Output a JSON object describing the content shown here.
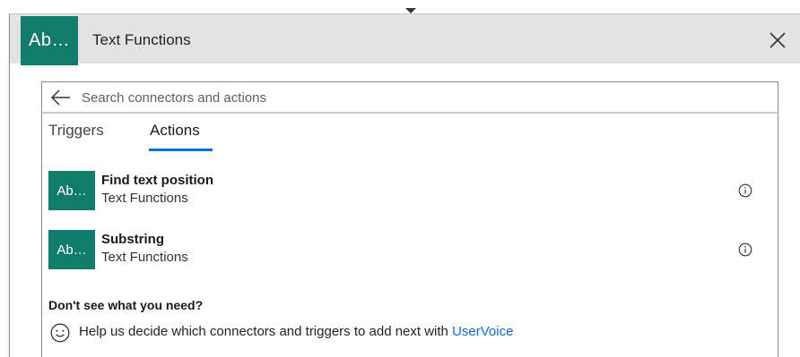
{
  "header": {
    "logo_text": "Ab…",
    "title": "Text Functions",
    "close_icon": "close-icon"
  },
  "search": {
    "back_icon": "back-arrow-icon",
    "placeholder": "Search connectors and actions",
    "value": ""
  },
  "tabs": [
    {
      "label": "Triggers",
      "selected": false
    },
    {
      "label": "Actions",
      "selected": true
    }
  ],
  "actions": [
    {
      "icon_text": "Ab…",
      "name": "Find text position",
      "connector": "Text Functions",
      "info_icon": "info-icon"
    },
    {
      "icon_text": "Ab…",
      "name": "Substring",
      "connector": "Text Functions",
      "info_icon": "info-icon"
    }
  ],
  "footer": {
    "heading": "Don't see what you need?",
    "help_icon": "smile-icon",
    "help_text": "Help us decide which connectors and triggers to add next with ",
    "link_text": "UserVoice"
  },
  "colors": {
    "brand": "#117c6a",
    "accent": "#0f6cd4",
    "header_bg": "#e3e3e3"
  }
}
